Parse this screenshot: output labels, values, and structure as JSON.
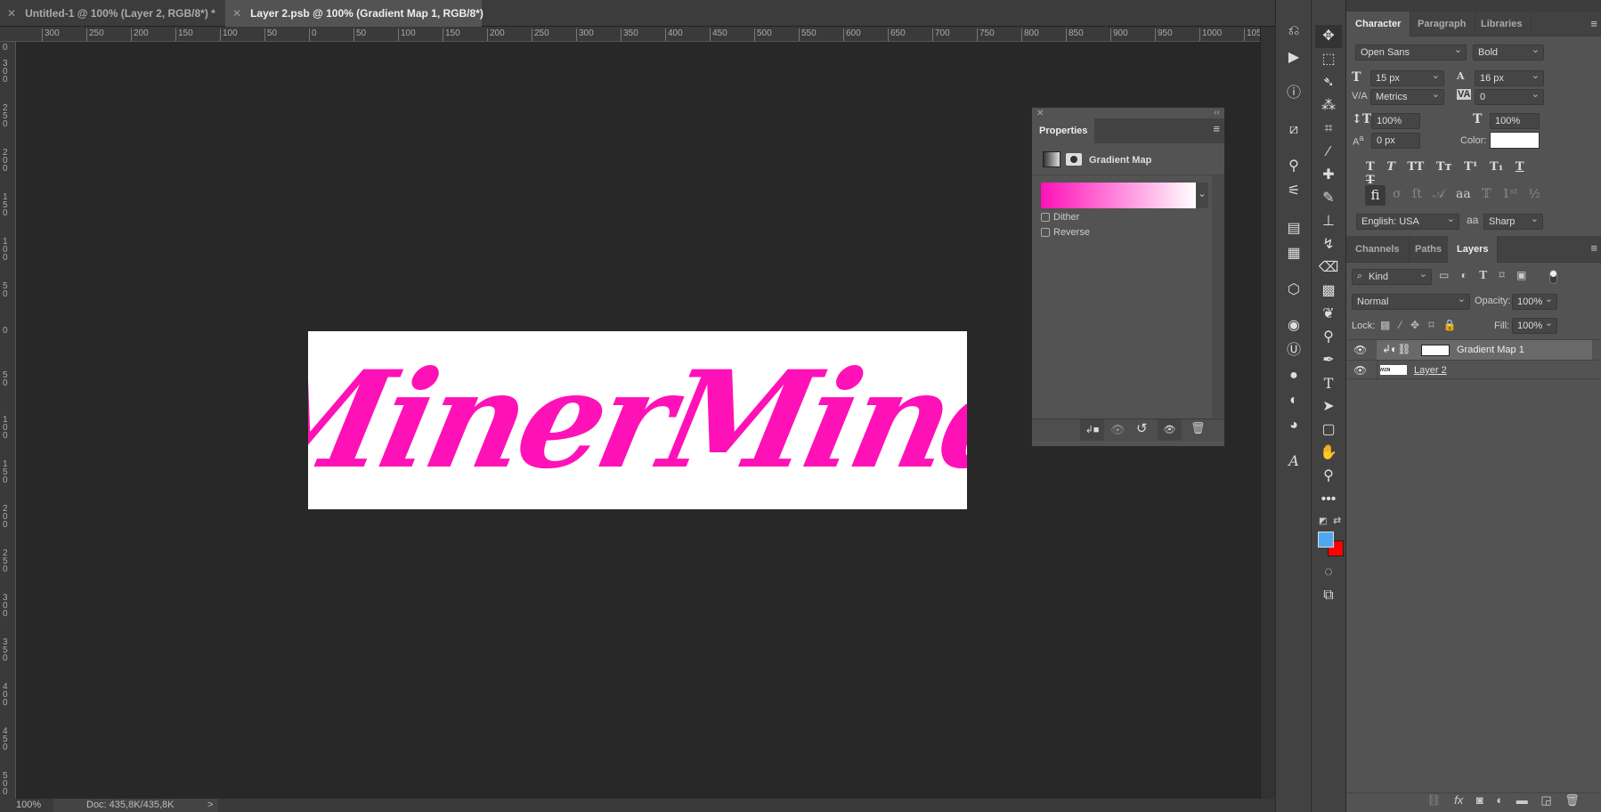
{
  "tabs": [
    {
      "label": "Untitled-1 @ 100% (Layer 2, RGB/8*) *",
      "active": false
    },
    {
      "label": "Layer 2.psb @ 100% (Gradient Map 1, RGB/8*)",
      "active": true
    }
  ],
  "ruler": {
    "h": [
      "300",
      "250",
      "200",
      "150",
      "100",
      "50",
      "0",
      "50",
      "100",
      "150",
      "200",
      "250",
      "300",
      "350",
      "400",
      "450",
      "500",
      "550",
      "600",
      "650",
      "700",
      "750",
      "800",
      "850",
      "900",
      "950",
      "1000",
      "105"
    ],
    "v": [
      "0",
      "300",
      "250",
      "200",
      "150",
      "100",
      "50",
      "0",
      "50",
      "100",
      "150",
      "200",
      "250",
      "300",
      "350",
      "400",
      "450",
      "500",
      "550"
    ]
  },
  "canvas": {
    "logo_text": "MinerMind",
    "logo_color": "#ff11b8",
    "background": "#ffffff"
  },
  "status": {
    "zoom": "100%",
    "doc": "Doc: 435,8K/435,8K",
    "arrow": ">"
  },
  "properties": {
    "title": "Properties",
    "type": "Gradient Map",
    "gradient": [
      "#ff11b8",
      "#ffffff"
    ],
    "dither": {
      "label": "Dither",
      "checked": false
    },
    "reverse": {
      "label": "Reverse",
      "checked": false
    }
  },
  "character": {
    "tabs": [
      "Character",
      "Paragraph",
      "Libraries"
    ],
    "font_family": "Open Sans",
    "font_style": "Bold",
    "size": "15 px",
    "leading": "16 px",
    "kerning": "Metrics",
    "tracking": "0",
    "vscale": "100%",
    "hscale": "100%",
    "baseline": "0 px",
    "color_label": "Color:",
    "color": "#ffffff",
    "language": "English: USA",
    "antialias": "Sharp",
    "aa_glyph": "aa"
  },
  "layers": {
    "tabs": [
      "Channels",
      "Paths",
      "Layers"
    ],
    "filter": "Kind",
    "blend": "Normal",
    "opacity_label": "Opacity:",
    "opacity": "100%",
    "lock_label": "Lock:",
    "fill_label": "Fill:",
    "fill": "100%",
    "items": [
      {
        "name": "Gradient Map 1",
        "visible": true,
        "selected": true
      },
      {
        "name": "Layer 2",
        "visible": true,
        "selected": false
      }
    ]
  },
  "colors": {
    "foreground": "#4fa8ef",
    "background": "#ff0000"
  }
}
